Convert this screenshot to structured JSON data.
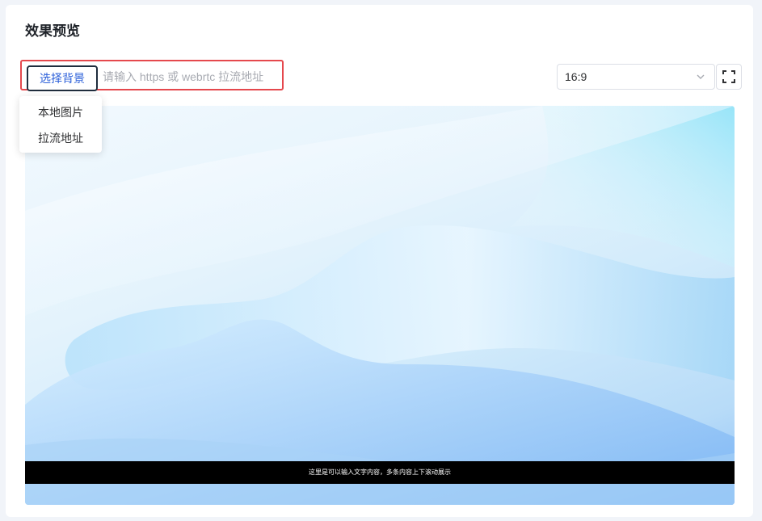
{
  "page": {
    "title": "效果预览"
  },
  "toolbar": {
    "bg_button_label": "选择背景",
    "stream_input_placeholder": "请输入 https 或 webrtc 拉流地址",
    "stream_input_value": "",
    "dropdown_items": [
      "本地图片",
      "拉流地址"
    ],
    "ratio_value": "16:9"
  },
  "icons": {
    "ratio_chevron": "chevron-down-icon",
    "fullscreen": "fullscreen-icon"
  },
  "preview": {
    "caption": "这里是可以输入文字内容，多条内容上下滚动展示"
  },
  "colors": {
    "accent": "#2b5fd9",
    "highlight_border": "#e5484d",
    "caption_bg": "#000000"
  }
}
